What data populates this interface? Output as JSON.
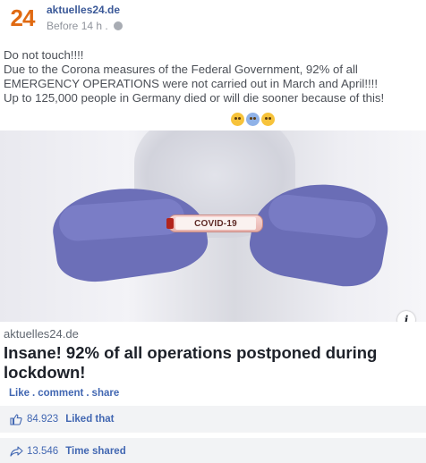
{
  "header": {
    "logo_text": "24",
    "page_name": "aktuelles24.de",
    "timestamp": "Before 14 h ."
  },
  "message": {
    "lines": [
      "Do not touch!!!!",
      "Due to the Corona measures of the Federal Government, 92% of all",
      "EMERGENCY OPERATIONS were not carried out in March and April!!!!",
      "Up to 125,000 people in Germany died or will die sooner because of this!"
    ],
    "emojis": [
      "flushed-face-emoji",
      "screaming-face-emoji",
      "astonished-face-emoji"
    ]
  },
  "image": {
    "vial_label": "COVID-19"
  },
  "link": {
    "domain": "aktuelles24.de",
    "headline": "Insane! 92% of all operations postponed during lockdown!"
  },
  "actions": {
    "like": "Like",
    "comment": "comment",
    "share": "share",
    "separator": "."
  },
  "stats": {
    "likes_count": "84.923",
    "likes_label": "Liked that",
    "shares_count": "13.546",
    "shares_label": "Time shared"
  },
  "colors": {
    "brand_orange": "#e06a12",
    "link_blue": "#4267b2",
    "glove_purple": "#6c6fb8"
  }
}
